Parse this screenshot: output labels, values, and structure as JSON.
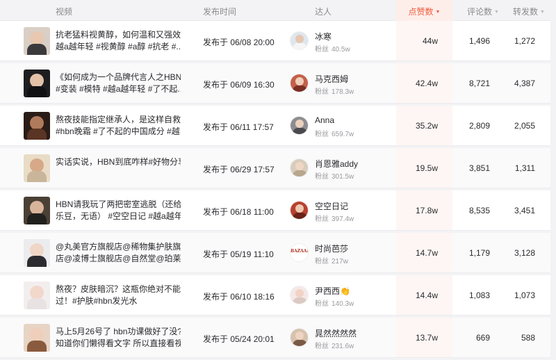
{
  "header": {
    "video": "视频",
    "time": "发布时间",
    "talent": "达人",
    "likes": "点赞数",
    "comments": "评论数",
    "shares": "转发数",
    "sort_caret": "▼"
  },
  "fans_label": "粉丝",
  "rows": [
    {
      "title_line1": "抗老猛料视黄醇，如何温和又强效#",
      "title_line2": "越a越年轻 #视黄醇 #a醇 #抗老 #...",
      "time": "发布于 06/08 20:00",
      "talent": "冰寒",
      "fans": "40.5w",
      "likes": "44w",
      "comments": "1,496",
      "shares": "1,272",
      "thumb_colors": [
        "#d9cfc6",
        "#e8c8b0",
        "#3a3a3c"
      ],
      "avatar_colors": [
        "#dfe6ee",
        "#e6c7b2",
        "#f6f6f6"
      ]
    },
    {
      "title_line1": "《如何成为一个品牌代言人之HBN》",
      "title_line2": "#变装 #模特 #越a越年轻 #了不起...",
      "time": "发布于 06/09 16:30",
      "talent": "马克西姆",
      "fans": "178.3w",
      "likes": "42.4w",
      "comments": "8,721",
      "shares": "4,387",
      "thumb_colors": [
        "#1e1e20",
        "#e4c2a8",
        "#111113"
      ],
      "avatar_colors": [
        "#c4604a",
        "#efcfba",
        "#7a2e24"
      ]
    },
    {
      "title_line1": "熬夜技能指定继承人，是这样自救的...",
      "title_line2": "#hbn晚霜 #了不起的中国成分 #越...",
      "time": "发布于 06/11 17:57",
      "talent": "Anna",
      "fans": "659.7w",
      "likes": "35.2w",
      "comments": "2,809",
      "shares": "2,055",
      "thumb_colors": [
        "#2a1c16",
        "#b07a5c",
        "#5a3424"
      ],
      "avatar_colors": [
        "#8d8d91",
        "#ead0bf",
        "#4a4a4e"
      ]
    },
    {
      "title_line1": "实话实说，HBN到底咋样#好物分享",
      "title_line2": "",
      "time": "发布于 06/29 17:57",
      "talent": "肖恩雅addy",
      "fans": "301.5w",
      "likes": "19.5w",
      "comments": "3,851",
      "shares": "1,311",
      "thumb_colors": [
        "#e9dcc6",
        "#d7a988",
        "#c9b59a"
      ],
      "avatar_colors": [
        "#d8cdbd",
        "#f0d6c4",
        "#b9a68e"
      ]
    },
    {
      "title_line1": "HBN请我玩了两把密室逃脱（还给欢",
      "title_line2": "乐豆，无语） #空空日记 #越a越年...",
      "time": "发布于 06/18 11:00",
      "talent": "空空日记",
      "fans": "397.4w",
      "likes": "17.8w",
      "comments": "8,535",
      "shares": "3,451",
      "thumb_colors": [
        "#4b4036",
        "#d8b49a",
        "#20201f"
      ],
      "avatar_colors": [
        "#b8412e",
        "#edc9b0",
        "#6b2218"
      ]
    },
    {
      "title_line1": "@丸美官方旗舰店@稀物集护肤旗舰",
      "title_line2": "店@凌博士旗舰店@自然堂@珀莱...",
      "time": "发布于 05/19 11:10",
      "talent": "时尚芭莎",
      "fans": "217w",
      "likes": "14.7w",
      "comments": "1,179",
      "shares": "3,128",
      "brand_text": "BAZAAR",
      "thumb_colors": [
        "#ececee",
        "#f0d6c6",
        "#2c2c30"
      ],
      "avatar_colors": [
        "#ffffff",
        "#ffffff",
        "#ffffff"
      ]
    },
    {
      "title_line1": "熬夜？皮肤暗沉？这瓶你绝对不能错",
      "title_line2": "过！#护肤#hbn发光水",
      "time": "发布于 06/10 18:16",
      "talent": "尹西西👏",
      "fans": "140.3w",
      "likes": "14.4w",
      "comments": "1,083",
      "shares": "1,073",
      "thumb_colors": [
        "#f3eeee",
        "#f2d7cb",
        "#e9e2e2"
      ],
      "avatar_colors": [
        "#f4e8e8",
        "#f1d3c5",
        "#dcc9c4"
      ]
    },
    {
      "title_line1": "马上5月26号了 hbn功课做好了没?",
      "title_line2": "知道你们懒得看文字 所以直接看视...",
      "time": "发布于 05/24 20:01",
      "talent": "晁然然然然",
      "fans": "231.6w",
      "likes": "13.7w",
      "comments": "669",
      "shares": "588",
      "thumb_colors": [
        "#e7d4c4",
        "#efcfbb",
        "#8a5a3e"
      ],
      "avatar_colors": [
        "#d6c2ae",
        "#f0d4c2",
        "#7a5a44"
      ]
    }
  ]
}
